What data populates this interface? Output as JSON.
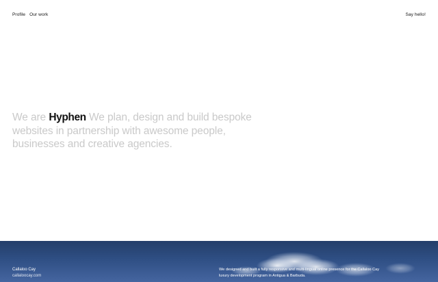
{
  "nav": {
    "profile": "Profile",
    "our_work": "Our work",
    "say_hello": "Say hello!"
  },
  "hero": {
    "we_are": "We are",
    "brand": "Hyphen",
    "tagline": "We plan, design and build bespoke websites in partnership with awesome people, businesses and creative agencies."
  },
  "project": {
    "title": "Callaloo Cay",
    "url": "callaloocay.com",
    "description": "We designed and built a fully responsive and multi-lingual online presence for the Callaloo Cay luxury development program in Antigua & Barbuda."
  },
  "colors": {
    "text_dark": "#111111",
    "hero_gray": "#c9c9c9",
    "sky_blue": "#2f4f84"
  }
}
